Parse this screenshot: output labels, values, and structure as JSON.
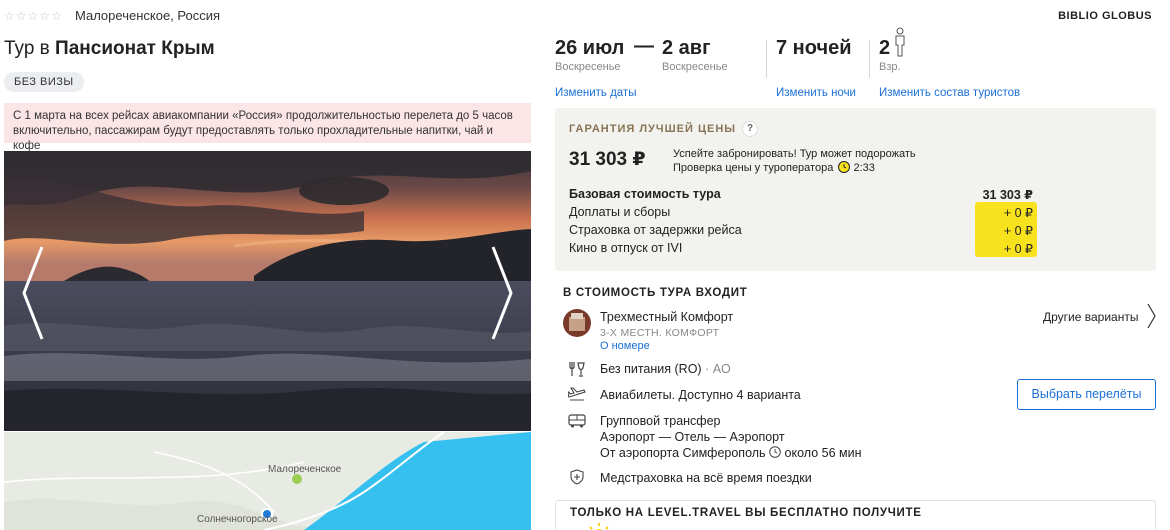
{
  "hotel": {
    "star_rating": 0,
    "location": "Малореченское, Россия",
    "title_prefix": "Тур в",
    "title_name": "Пансионат Крым",
    "visa_badge": "БЕЗ ВИЗЫ"
  },
  "notice": "С 1 марта на всех рейсах авиакомпании «Россия» продолжительностью перелета до 5 часов включительно, пассажирам будут предоставлять только прохладительные напитки, чай и кофе",
  "brand": "BIBLIO GLOBUS",
  "trip": {
    "date_from": "26 июл",
    "date_from_day": "Воскресенье",
    "dash": "—",
    "date_to": "2 авг",
    "date_to_day": "Воскресенье",
    "nights": "7 ночей",
    "adults": "2",
    "adults_label": "Взр.",
    "change_dates": "Изменить даты",
    "change_nights": "Изменить ночи",
    "change_tourists": "Изменить состав туристов"
  },
  "price": {
    "guarantee_label": "ГАРАНТИЯ ЛУЧШЕЙ ЦЕНЫ",
    "help": "?",
    "total": "31 303 ₽",
    "hurry_line1": "Успейте забронировать! Тур может подорожать",
    "hurry_line2": "Проверка цены у туроператора",
    "timer": "2:33",
    "rows": [
      {
        "label": "Базовая стоимость тура",
        "value": "31 303 ₽"
      },
      {
        "label": "Доплаты и сборы",
        "value": "+ 0 ₽"
      },
      {
        "label": "Страховка от задержки рейса",
        "value": "+ 0 ₽"
      },
      {
        "label": "Кино в отпуск от IVI",
        "value": "+ 0 ₽"
      }
    ]
  },
  "included": {
    "title": "В СТОИМОСТЬ ТУРА ВХОДИТ",
    "room_name": "Трехместный Комфорт",
    "room_type": "3-Х МЕСТН. КОМФОРТ",
    "room_link": "О номере",
    "other_variants": "Другие варианты",
    "meal": "Без питания (RO)",
    "meal_sep": "·",
    "meal_code": "AO",
    "flights": "Авиабилеты. Доступно 4 варианта",
    "choose_flights": "Выбрать перелёты",
    "transfer": "Групповой трансфер",
    "transfer_route": "Аэропорт — Отель — Аэропорт",
    "transfer_from": "От аэропорта Симферополь",
    "transfer_time": "около 56 мин",
    "insurance": "Медстраховка на всё время поездки"
  },
  "bottom_box_title": "ТОЛЬКО НА LEVEL.TRAVEL ВЫ БЕСПЛАТНО ПОЛУЧИТЕ",
  "map": {
    "label1": "Малореченское",
    "label2": "Солнечногорское"
  },
  "colors": {
    "link": "#1a6fd6",
    "notice_bg": "#fbe5e7",
    "price_box_bg": "#f2f2ef",
    "highlight": "#f8e21e",
    "sea": "#35c0f0"
  }
}
